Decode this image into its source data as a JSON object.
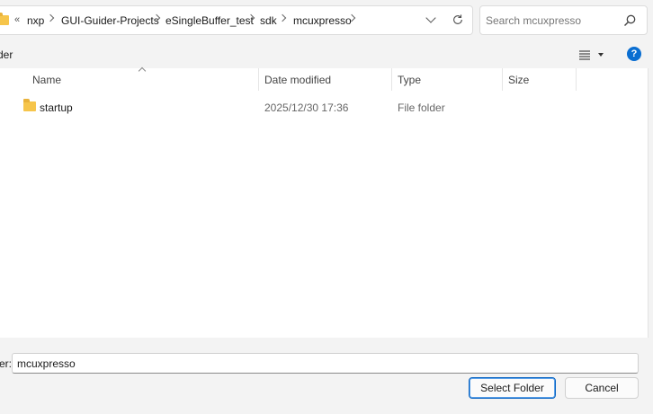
{
  "address_bar": {
    "overflow_label": "«",
    "breadcrumbs": [
      "nxp",
      "GUI-Guider-Projects",
      "eSingleBuffer_test",
      "sdk",
      "mcuxpresso"
    ]
  },
  "search": {
    "placeholder": "Search mcuxpresso",
    "value": ""
  },
  "command_bar": {
    "label": "der"
  },
  "columns": {
    "name": "Name",
    "date": "Date modified",
    "type": "Type",
    "size": "Size"
  },
  "rows": [
    {
      "name": "startup",
      "date": "2025/12/30 17:36",
      "type": "File folder",
      "size": ""
    }
  ],
  "footer": {
    "filename_label": "er:",
    "filename_value": "mcuxpresso",
    "select_button": "Select Folder",
    "cancel_button": "Cancel"
  },
  "colors": {
    "accent": "#0a6ed1",
    "folder": "#f6c54b"
  },
  "icons": [
    "folder-icon",
    "chevron-right-icon",
    "chevron-down-icon",
    "refresh-icon",
    "search-icon",
    "view-list-icon",
    "help-icon"
  ]
}
